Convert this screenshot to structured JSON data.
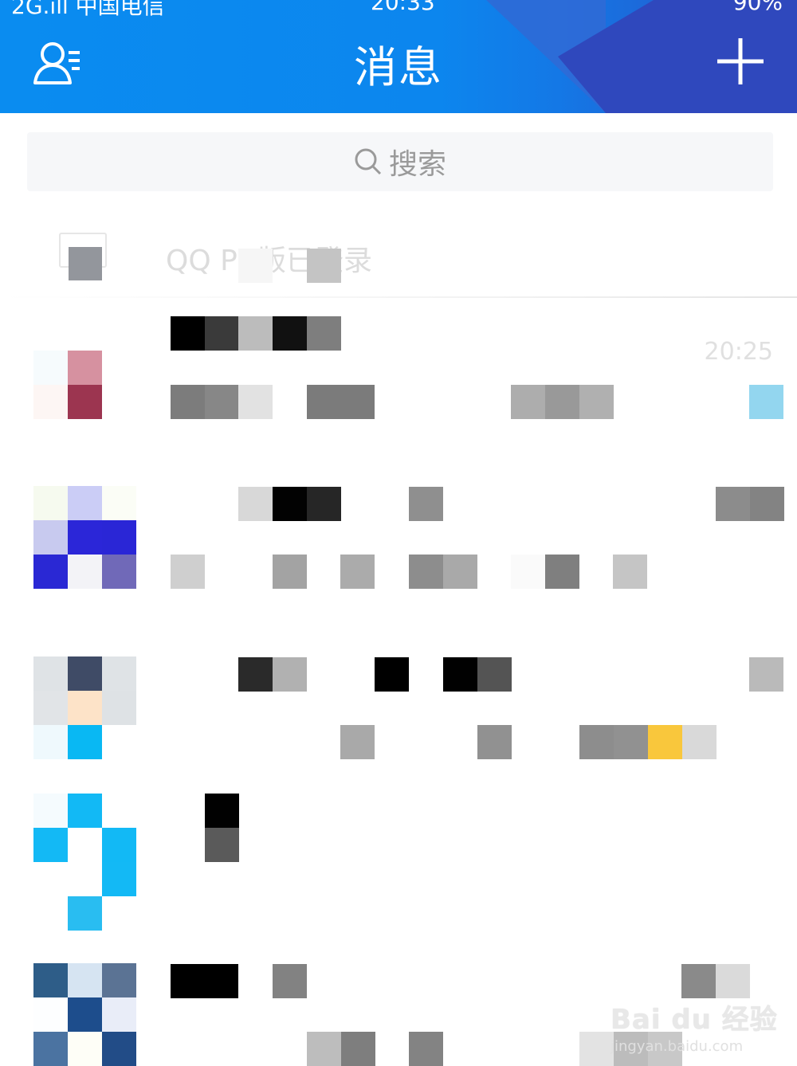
{
  "status_bar": {
    "left": "2G.ıll 中国电信",
    "time": "20:33",
    "right": "90%"
  },
  "header": {
    "title": "消息"
  },
  "search": {
    "placeholder": "搜索"
  },
  "pc_notice": {
    "text": "QQ PC版已登录"
  },
  "chats": [
    {
      "time": "20:25"
    },
    {
      "time": ""
    },
    {
      "time": ""
    },
    {
      "time": ""
    },
    {
      "time": ""
    }
  ],
  "watermark": {
    "main": "Bai du 经验",
    "sub": "jingyan.baidu.com"
  },
  "colors": {
    "header_blue": "#0a8cf0",
    "header_dark": "#2f48bd"
  }
}
